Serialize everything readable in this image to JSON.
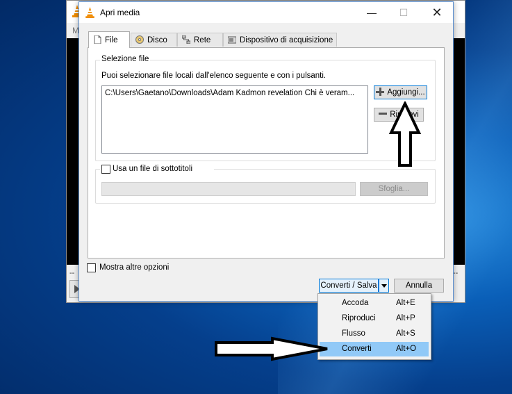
{
  "background_window": {
    "menu_initial": "M",
    "time_left": "--",
    "time_right": "--"
  },
  "dialog": {
    "title": "Apri media",
    "tabs": [
      {
        "label": "File",
        "icon": "file-icon",
        "active": true
      },
      {
        "label": "Disco",
        "icon": "disc-icon",
        "active": false
      },
      {
        "label": "Rete",
        "icon": "network-icon",
        "active": false
      },
      {
        "label": "Dispositivo di acquisizione",
        "icon": "capture-device-icon",
        "active": false
      }
    ],
    "file_selection": {
      "group_title": "Selezione file",
      "hint": "Puoi selezionare file locali dall'elenco seguente e con i pulsanti.",
      "files": [
        "C:\\Users\\Gaetano\\Downloads\\Adam Kadmon revelation Chi è veram..."
      ],
      "add_button": "Aggiungi...",
      "remove_button": "Rimuovi"
    },
    "subtitles": {
      "checkbox_label": "Usa un file di sottotitoli",
      "checked": false,
      "path_value": "",
      "browse_button": "Sfoglia..."
    },
    "more_options": {
      "checkbox_label": "Mostra altre opzioni",
      "checked": false
    },
    "primary_button": "Converti / Salva",
    "cancel_button": "Annulla"
  },
  "dropdown_menu": {
    "items": [
      {
        "label": "Accoda",
        "shortcut": "Alt+E",
        "highlighted": false
      },
      {
        "label": "Riproduci",
        "shortcut": "Alt+P",
        "highlighted": false
      },
      {
        "label": "Flusso",
        "shortcut": "Alt+S",
        "highlighted": false
      },
      {
        "label": "Converti",
        "shortcut": "Alt+O",
        "highlighted": true
      }
    ]
  },
  "colors": {
    "vlc_orange": "#f08c00",
    "menu_highlight": "#91c9f7",
    "focus_border": "#0078d7",
    "desktop_blue": "#0a5fb8"
  }
}
